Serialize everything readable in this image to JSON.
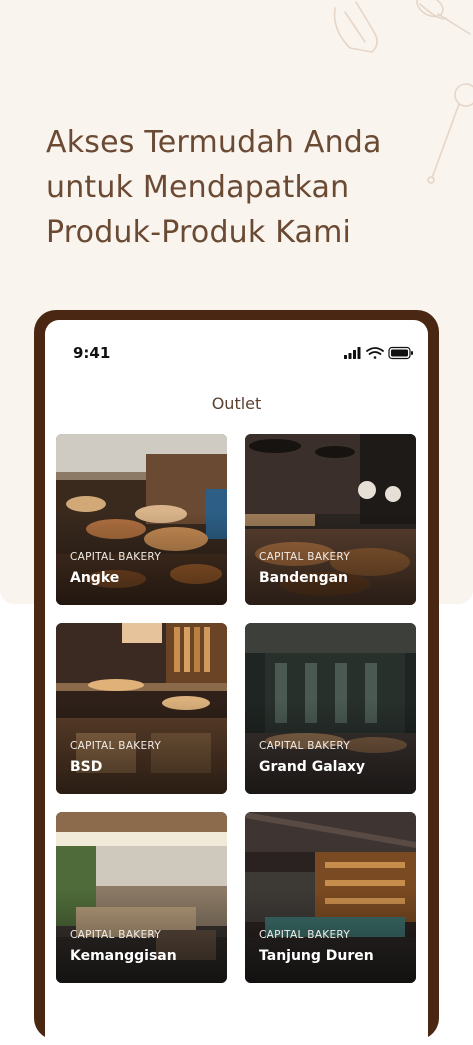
{
  "headline": {
    "line1": "Akses Termudah Anda",
    "line2": "untuk Mendapatkan",
    "line3": "Produk-Produk Kami"
  },
  "phone": {
    "status_time": "9:41",
    "screen_title": "Outlet"
  },
  "outlets": [
    {
      "brand": "CAPITAL BAKERY",
      "name": "Angke"
    },
    {
      "brand": "CAPITAL BAKERY",
      "name": "Bandengan"
    },
    {
      "brand": "CAPITAL BAKERY",
      "name": "BSD"
    },
    {
      "brand": "CAPITAL BAKERY",
      "name": "Grand Galaxy"
    },
    {
      "brand": "CAPITAL BAKERY",
      "name": "Kemanggisan"
    },
    {
      "brand": "CAPITAL BAKERY",
      "name": "Tanjung Duren"
    }
  ],
  "colors": {
    "hero_background": "#f9f4ee",
    "headline_text": "#6b4a34",
    "phone_frame": "#4a2712"
  },
  "icons": [
    "bakery-utensils-decoration-icon",
    "signal-icon",
    "wifi-icon",
    "battery-icon"
  ]
}
